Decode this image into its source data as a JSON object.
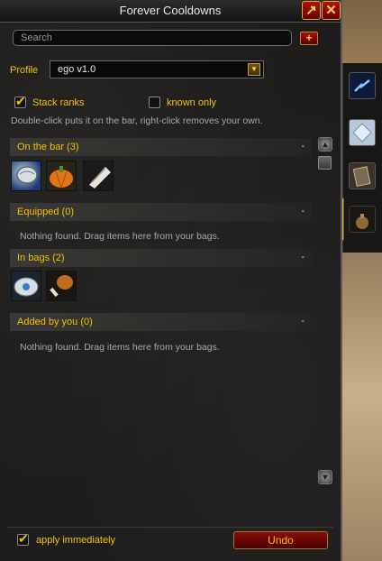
{
  "window": {
    "title": "Forever Cooldowns",
    "popout_label": "↗",
    "close_label": "✕"
  },
  "search": {
    "placeholder": "Search",
    "value": "",
    "add_label": "+"
  },
  "profile": {
    "label": "Profile",
    "value": "ego v1.0",
    "dropdown_icon": "▼"
  },
  "options": {
    "stack_ranks": {
      "label": "Stack ranks",
      "checked": true
    },
    "known_only": {
      "label": "known only",
      "checked": false
    }
  },
  "hint": "Double-click puts it on the bar, right-click removes your own.",
  "sections": {
    "on_bar": {
      "label": "On the bar  (3)",
      "collapse": "-"
    },
    "equipped": {
      "label": "Equipped  (0)",
      "collapse": "-",
      "empty": "Nothing found. Drag items here from your bags."
    },
    "in_bags": {
      "label": "In bags  (2)",
      "collapse": "-"
    },
    "added": {
      "label": "Added by you  (0)",
      "collapse": "-",
      "empty": "Nothing found. Drag items here from your bags."
    }
  },
  "scroll": {
    "up": "▲",
    "down": "▼"
  },
  "footer": {
    "apply_immediately": {
      "label": "apply immediately",
      "checked": true
    },
    "undo_label": "Undo"
  }
}
